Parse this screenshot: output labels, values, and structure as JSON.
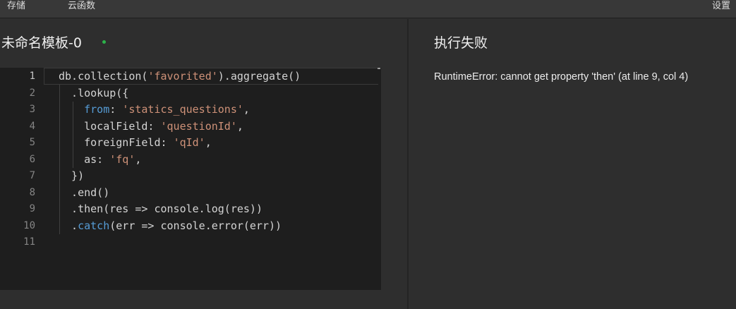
{
  "topbar": {
    "tabs": [
      {
        "label": "存储"
      },
      {
        "label": "云函数"
      }
    ],
    "settings_label": "设置"
  },
  "editor_panel": {
    "template_title": "未命名模板-0",
    "status_color": "#2cb24a",
    "active_line": 1,
    "lines": [
      {
        "n": "1",
        "code": "db.collection('favorited').aggregate()"
      },
      {
        "n": "2",
        "code": "  .lookup({"
      },
      {
        "n": "3",
        "code": "    from: 'statics_questions',"
      },
      {
        "n": "4",
        "code": "    localField: 'questionId',"
      },
      {
        "n": "5",
        "code": "    foreignField: 'qId',"
      },
      {
        "n": "6",
        "code": "    as: 'fq',"
      },
      {
        "n": "7",
        "code": "  })"
      },
      {
        "n": "8",
        "code": "  .end()"
      },
      {
        "n": "9",
        "code": "  .then(res => console.log(res))"
      },
      {
        "n": "10",
        "code": "  .catch(err => console.error(err))"
      },
      {
        "n": "11",
        "code": ""
      }
    ]
  },
  "result_panel": {
    "title": "执行失败",
    "message": "RuntimeError: cannot get property 'then' (at line 9, col 4)"
  }
}
